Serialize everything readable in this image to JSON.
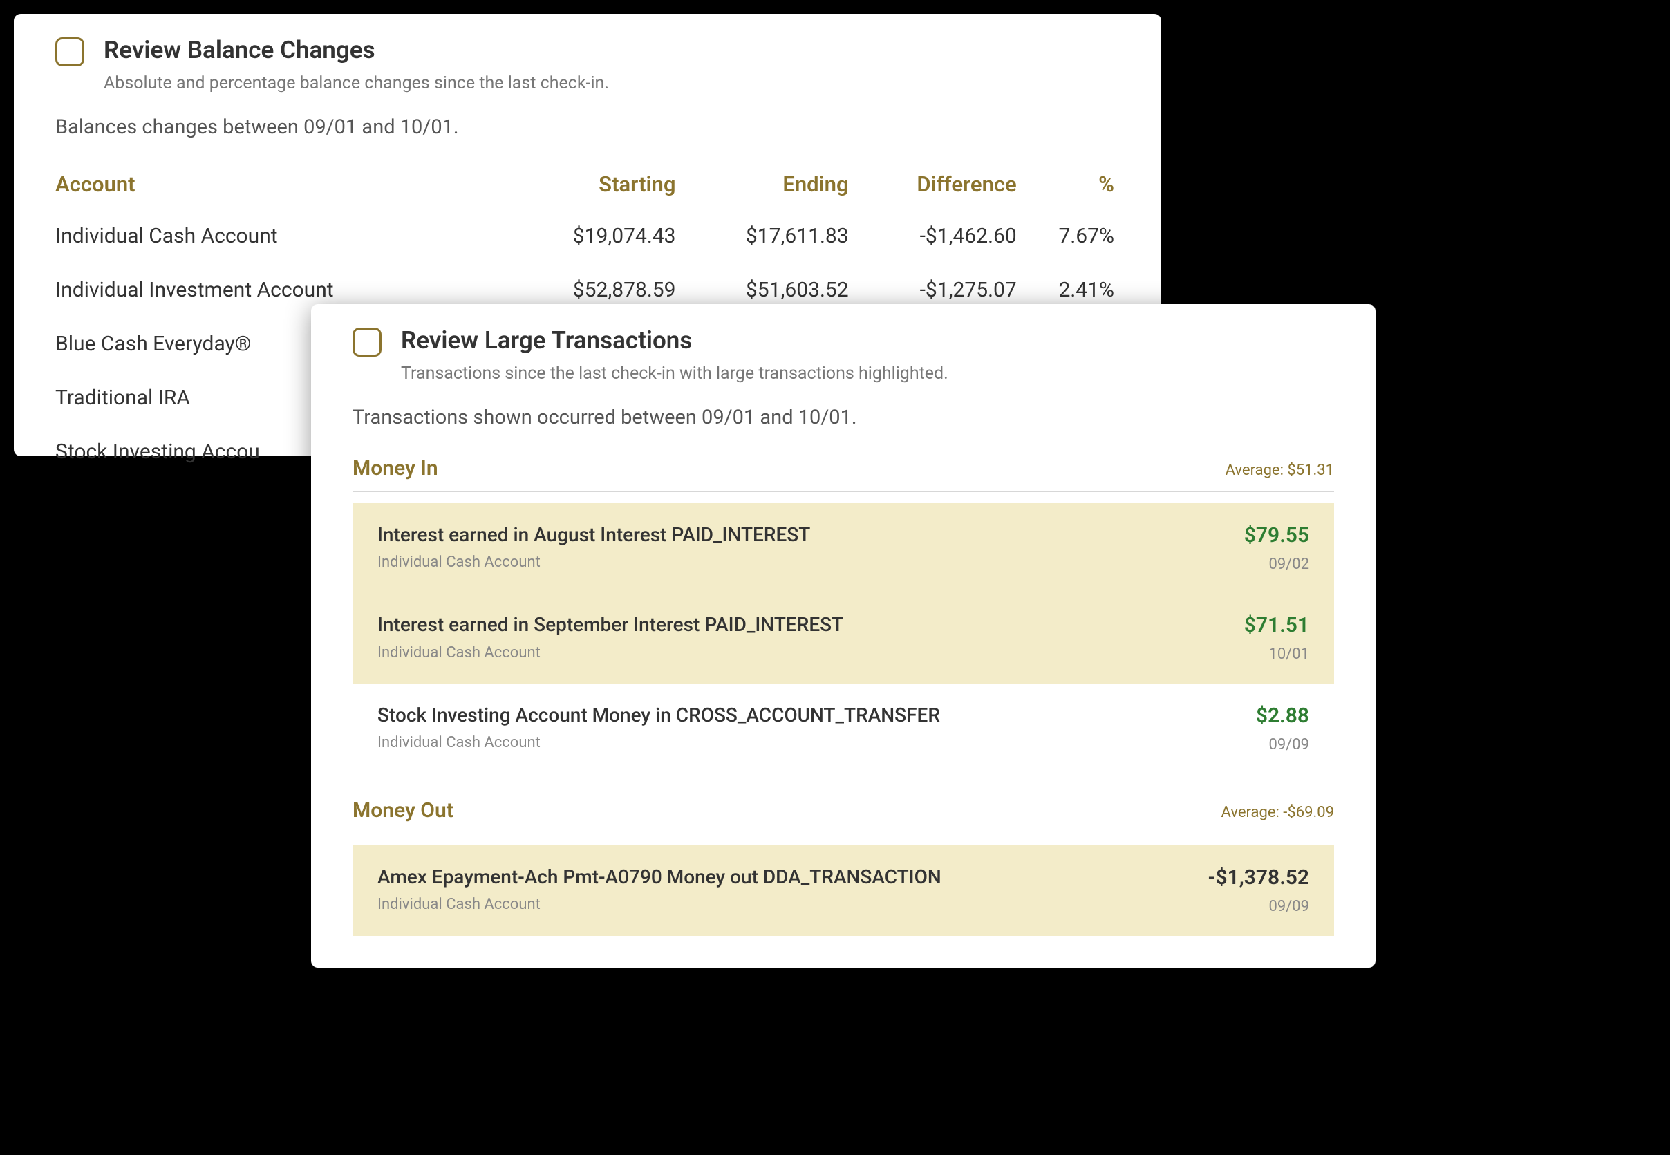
{
  "balance_card": {
    "title": "Review Balance Changes",
    "subtitle": "Absolute and percentage balance changes since the last check-in.",
    "summary": "Balances changes between 09/01 and 10/01.",
    "columns": {
      "account": "Account",
      "starting": "Starting",
      "ending": "Ending",
      "difference": "Difference",
      "percent": "%"
    },
    "rows": [
      {
        "account": "Individual Cash Account",
        "starting": "$19,074.43",
        "ending": "$17,611.83",
        "difference": "-$1,462.60",
        "percent": "7.67%"
      },
      {
        "account": "Individual Investment Account",
        "starting": "$52,878.59",
        "ending": "$51,603.52",
        "difference": "-$1,275.07",
        "percent": "2.41%"
      },
      {
        "account": "Blue Cash Everyday®",
        "starting": "",
        "ending": "",
        "difference": "",
        "percent": ""
      },
      {
        "account": "Traditional IRA",
        "starting": "",
        "ending": "",
        "difference": "",
        "percent": ""
      },
      {
        "account": "Stock Investing Accou",
        "starting": "",
        "ending": "",
        "difference": "",
        "percent": ""
      }
    ]
  },
  "tx_card": {
    "title": "Review Large Transactions",
    "subtitle": "Transactions since the last check-in with large transactions highlighted.",
    "summary": "Transactions shown occurred between 09/01 and 10/01.",
    "money_in": {
      "heading": "Money In",
      "average_label": "Average: $51.31",
      "items": [
        {
          "desc": "Interest earned in August Interest PAID_INTEREST",
          "sub": "Individual Cash Account",
          "amount": "$79.55",
          "date": "09/02",
          "highlight": true,
          "positive": true
        },
        {
          "desc": "Interest earned in September Interest PAID_INTEREST",
          "sub": "Individual Cash Account",
          "amount": "$71.51",
          "date": "10/01",
          "highlight": true,
          "positive": true
        },
        {
          "desc": "Stock Investing Account Money in CROSS_ACCOUNT_TRANSFER",
          "sub": "Individual Cash Account",
          "amount": "$2.88",
          "date": "09/09",
          "highlight": false,
          "positive": true
        }
      ]
    },
    "money_out": {
      "heading": "Money Out",
      "average_label": "Average: -$69.09",
      "items": [
        {
          "desc": "Amex Epayment-Ach Pmt-A0790 Money out DDA_TRANSACTION",
          "sub": "Individual Cash Account",
          "amount": "-$1,378.52",
          "date": "09/09",
          "highlight": true,
          "positive": false
        }
      ]
    }
  }
}
